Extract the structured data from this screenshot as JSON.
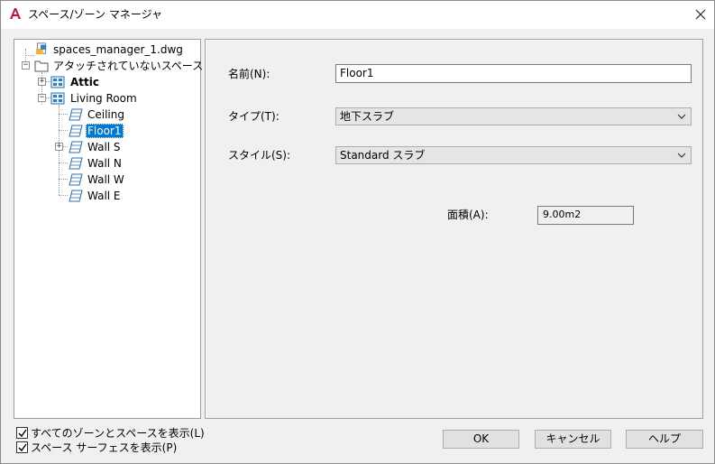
{
  "window": {
    "title": "スペース/ゾーン マネージャ",
    "app_icon": "autocad-a-icon",
    "close_icon": "close-icon"
  },
  "tree": {
    "root": {
      "label": "spaces_manager_1.dwg",
      "icon": "drawing-file-icon"
    },
    "unattached": {
      "label": "アタッチされていないスペース",
      "icon": "folder-icon"
    },
    "attic": {
      "label": "Attic",
      "icon": "zone-icon"
    },
    "living_room": {
      "label": "Living Room",
      "icon": "zone-icon"
    },
    "ceiling": {
      "label": "Ceiling",
      "icon": "surface-icon"
    },
    "floor1": {
      "label": "Floor1",
      "icon": "surface-icon",
      "selected": true
    },
    "wall_s": {
      "label": "Wall S",
      "icon": "surface-icon"
    },
    "wall_n": {
      "label": "Wall N",
      "icon": "surface-icon"
    },
    "wall_w": {
      "label": "Wall W",
      "icon": "surface-icon"
    },
    "wall_e": {
      "label": "Wall E",
      "icon": "surface-icon"
    }
  },
  "details": {
    "name_label": "名前(N):",
    "name_value": "Floor1",
    "type_label": "タイプ(T):",
    "type_value": "地下スラブ",
    "style_label": "スタイル(S):",
    "style_value": "Standard スラブ",
    "area_label": "面積(A):",
    "area_value": "9.00m2"
  },
  "options": {
    "show_all_label": "すべてのゾーンとスペースを表示(L)",
    "show_all_checked": true,
    "show_surfaces_label": "スペース サーフェスを表示(P)",
    "show_surfaces_checked": true
  },
  "buttons": {
    "ok": "OK",
    "cancel": "キャンセル",
    "help": "ヘルプ"
  },
  "colors": {
    "selection": "#0078d7",
    "app_icon_red": "#c8102e"
  }
}
